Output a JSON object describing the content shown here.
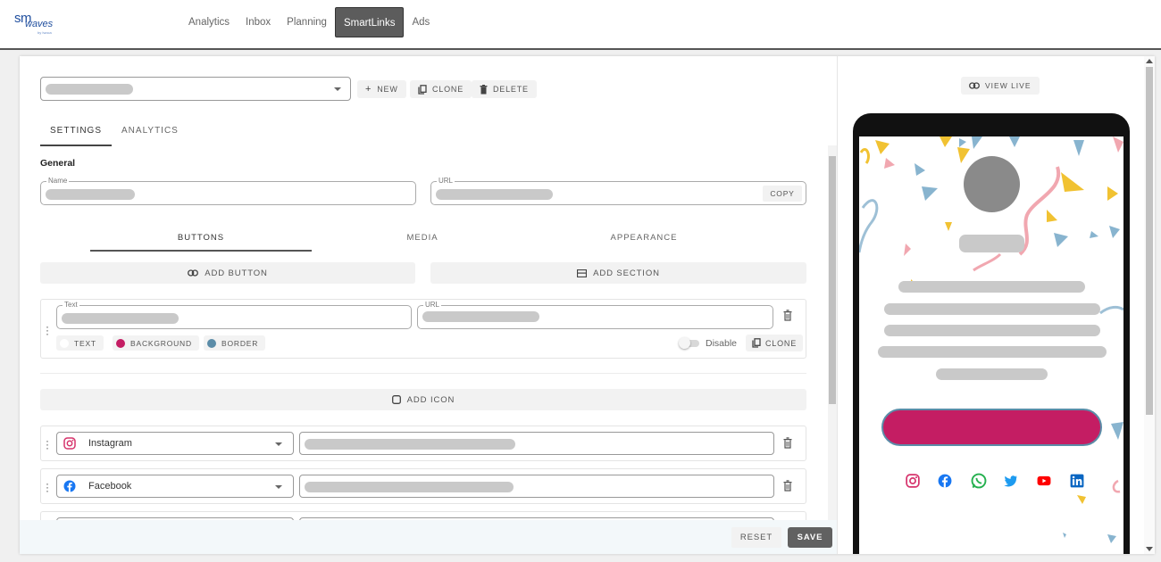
{
  "app": {
    "logo_main": "sm",
    "logo_sub": "waves",
    "logo_tag": "by Iwoca"
  },
  "nav": {
    "items": [
      {
        "label": "Analytics",
        "active": false
      },
      {
        "label": "Inbox",
        "active": false
      },
      {
        "label": "Planning",
        "active": false
      },
      {
        "label": "SmartLinks",
        "active": true
      },
      {
        "label": "Ads",
        "active": false
      }
    ]
  },
  "toolbar": {
    "new_label": "NEW",
    "clone_label": "CLONE",
    "delete_label": "DELETE"
  },
  "main_tabs": [
    {
      "label": "SETTINGS",
      "active": true
    },
    {
      "label": "ANALYTICS",
      "active": false
    }
  ],
  "general": {
    "title": "General",
    "name_label": "Name",
    "url_label": "URL",
    "copy_label": "COPY"
  },
  "sub_tabs": [
    {
      "label": "BUTTONS",
      "active": true
    },
    {
      "label": "MEDIA",
      "active": false
    },
    {
      "label": "APPEARANCE",
      "active": false
    }
  ],
  "actions": {
    "add_button_label": "ADD BUTTON",
    "add_section_label": "ADD SECTION",
    "add_icon_label": "ADD ICON"
  },
  "button_row": {
    "text_label": "Text",
    "url_label": "URL",
    "chips": [
      {
        "label": "TEXT",
        "color": "#ffffff"
      },
      {
        "label": "BACKGROUND",
        "color": "#c41d63"
      },
      {
        "label": "BORDER",
        "color": "#5b8ca8"
      }
    ],
    "disable_label": "Disable",
    "clone_label": "CLONE"
  },
  "social_rows": [
    {
      "platform": "Instagram",
      "icon": "instagram-icon"
    },
    {
      "platform": "Facebook",
      "icon": "facebook-icon"
    }
  ],
  "footer": {
    "reset_label": "RESET",
    "save_label": "SAVE"
  },
  "preview": {
    "view_live_label": "VIEW LIVE",
    "button_color": "#c41d63",
    "button_border_color": "#5b8ca8",
    "social_icons": [
      "instagram-icon",
      "facebook-icon",
      "whatsapp-icon",
      "twitter-icon",
      "youtube-icon",
      "linkedin-icon"
    ]
  }
}
